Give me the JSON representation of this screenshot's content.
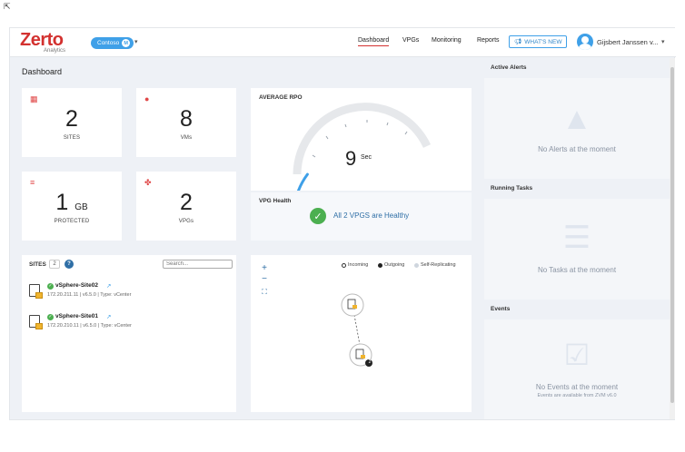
{
  "brand": {
    "logo": "Zerto",
    "sublabel": "Analytics"
  },
  "org": {
    "name": "Contoso",
    "count": "M"
  },
  "nav": {
    "items": [
      {
        "label": "Dashboard"
      },
      {
        "label": "VPGs"
      },
      {
        "label": "Monitoring"
      },
      {
        "label": "Reports"
      }
    ],
    "whats_new": "WHAT'S NEW"
  },
  "user": {
    "name": "Gijsbert Janssen v..."
  },
  "page": {
    "title": "Dashboard"
  },
  "tiles": {
    "sites": {
      "icon": "sites-icon",
      "value": "2",
      "label": "SITES"
    },
    "vms": {
      "icon": "vm-icon",
      "value": "8",
      "label": "VMs"
    },
    "protected": {
      "icon": "database-icon",
      "value": "1",
      "unit": "GB",
      "label": "PROTECTED"
    },
    "vpgs": {
      "icon": "vpg-icon",
      "value": "2",
      "label": "VPGs"
    }
  },
  "rpo": {
    "title": "AVERAGE RPO",
    "value": "9",
    "unit": "Sec",
    "gauge_fraction": 0.12
  },
  "vpg_health": {
    "title": "VPG Health",
    "status": "All 2 VPGS are Healthy"
  },
  "sites_list": {
    "title": "SITES",
    "count": "2",
    "help": "?",
    "search_placeholder": "Search...",
    "items": [
      {
        "name": "vSphere-Site02",
        "meta": "172.20.211.11 | v6.5.0 | Type: vCenter"
      },
      {
        "name": "vSphere-Site01",
        "meta": "172.20.210.11 | v6.5.0 | Type: vCenter"
      }
    ]
  },
  "topology": {
    "zoom_in": "+",
    "zoom_out": "−",
    "fit": "⛶",
    "legend": [
      "Incoming",
      "Outgoing",
      "Self-Replicating"
    ],
    "node_badge": "2"
  },
  "right_panel": {
    "alerts": {
      "title": "Active Alerts",
      "empty": "No Alerts at the moment"
    },
    "tasks": {
      "title": "Running Tasks",
      "empty": "No Tasks at the moment"
    },
    "events": {
      "title": "Events",
      "empty": "No Events at the moment",
      "sub": "Events are available from ZVM v6.0"
    }
  },
  "colors": {
    "brand_red": "#d3312f",
    "accent_blue": "#3fa0e8",
    "ok_green": "#4caf50"
  }
}
